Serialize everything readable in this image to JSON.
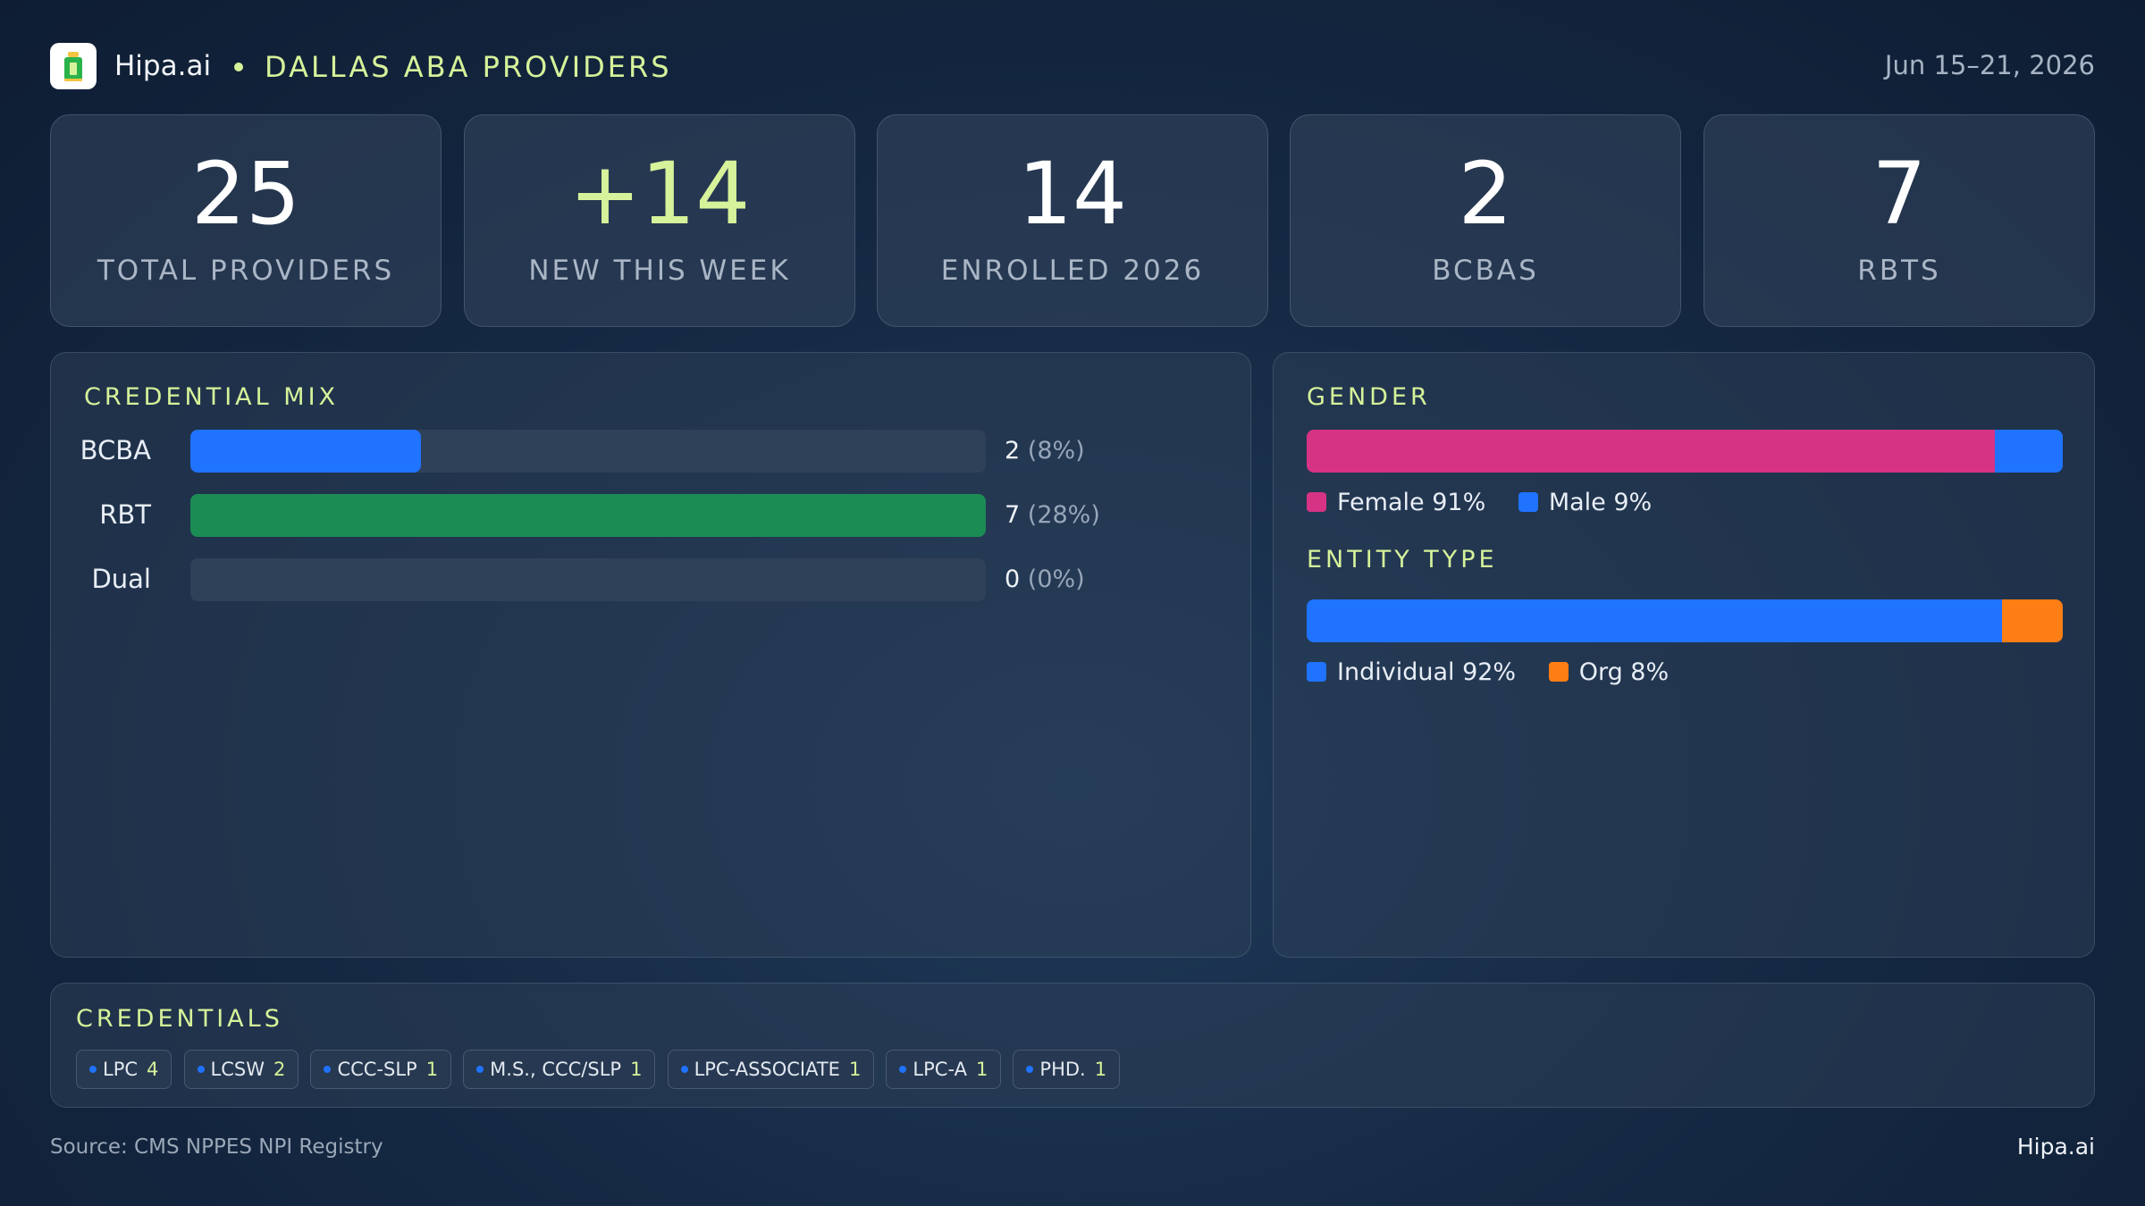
{
  "header": {
    "brand": "Hipa.ai",
    "title": "DALLAS ABA PROVIDERS",
    "date_range": "Jun 15–21, 2026"
  },
  "kpis": [
    {
      "value": "25",
      "label": "TOTAL PROVIDERS"
    },
    {
      "value": "+14",
      "label": "NEW THIS WEEK"
    },
    {
      "value": "14",
      "label": "ENROLLED 2026"
    },
    {
      "value": "2",
      "label": "BCBAS"
    },
    {
      "value": "7",
      "label": "RBTS"
    }
  ],
  "credential_mix": {
    "title": "CREDENTIAL MIX",
    "rows": [
      {
        "label": "BCBA",
        "count": "2",
        "pct": "(8%)",
        "color": "#1f73ff",
        "fraction": 0.29
      },
      {
        "label": "RBT",
        "count": "7",
        "pct": "(28%)",
        "color": "#1c8c55",
        "fraction": 1.0
      },
      {
        "label": "Dual",
        "count": "0",
        "pct": "(0%)",
        "color": "#1f73ff",
        "fraction": 0.0
      }
    ]
  },
  "gender": {
    "title": "GENDER",
    "segments": [
      {
        "label": "Female 91%",
        "percent": 91,
        "color": "#d63384"
      },
      {
        "label": "Male 9%",
        "percent": 9,
        "color": "#1f73ff"
      }
    ]
  },
  "entity_type": {
    "title": "ENTITY TYPE",
    "segments": [
      {
        "label": "Individual 92%",
        "percent": 92,
        "color": "#1f73ff"
      },
      {
        "label": "Org 8%",
        "percent": 8,
        "color": "#fd7e14"
      }
    ]
  },
  "credentials": {
    "title": "CREDENTIALS",
    "chips": [
      {
        "label": "LPC",
        "count": "4"
      },
      {
        "label": "LCSW",
        "count": "2"
      },
      {
        "label": "CCC-SLP",
        "count": "1"
      },
      {
        "label": "M.S., CCC/SLP",
        "count": "1"
      },
      {
        "label": "LPC-ASSOCIATE",
        "count": "1"
      },
      {
        "label": "LPC-A",
        "count": "1"
      },
      {
        "label": "PHD.",
        "count": "1"
      }
    ]
  },
  "footer": {
    "source": "Source: CMS NPPES NPI Registry",
    "brand": "Hipa.ai"
  }
}
